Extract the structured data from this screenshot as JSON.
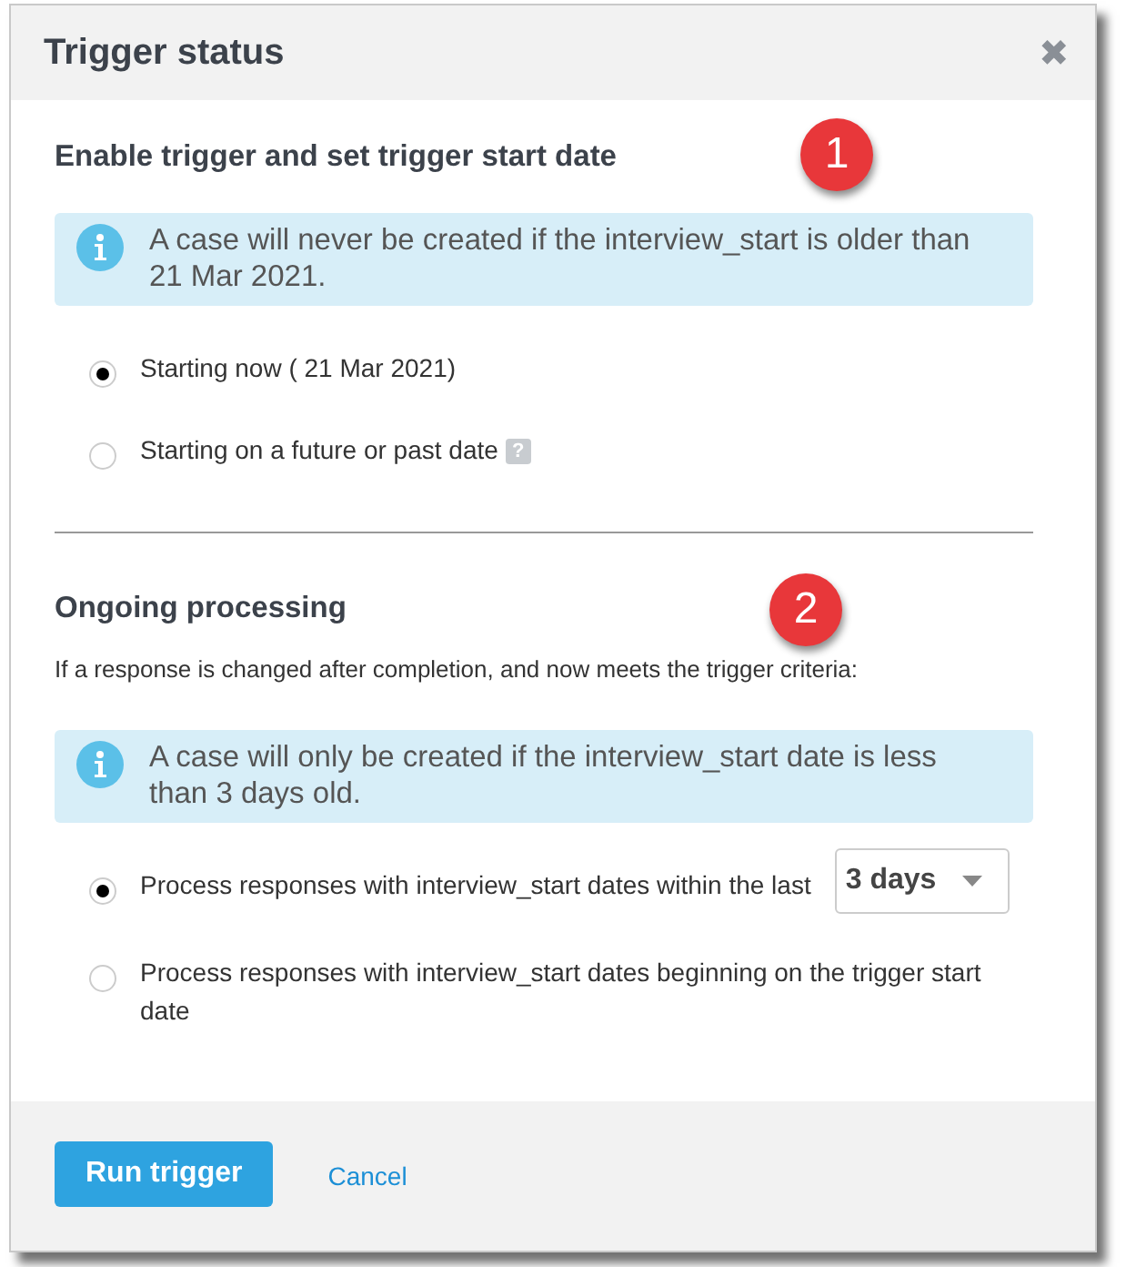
{
  "dialog": {
    "title": "Trigger status",
    "close": "✖"
  },
  "sections": [
    {
      "heading": "Enable trigger and set trigger start date",
      "marker": "1",
      "info": "A case will never be created if the interview_start is older than 21 Mar 2021.",
      "options": [
        {
          "label": "Starting now ( 21 Mar 2021)",
          "selected": true
        },
        {
          "label": "Starting on a future or past date",
          "selected": false,
          "help": "?"
        }
      ]
    },
    {
      "heading": "Ongoing processing",
      "marker": "2",
      "intro": "If a response is changed after completion, and now meets the trigger criteria:",
      "info": "A case will only be created if the interview_start date is less than 3 days old.",
      "options": [
        {
          "label": "Process responses with interview_start dates within the last",
          "selected": true,
          "select": "3 days"
        },
        {
          "label": "Process responses with interview_start dates beginning on the trigger start date",
          "selected": false
        }
      ]
    }
  ],
  "footer": {
    "primary": "Run trigger",
    "secondary": "Cancel"
  }
}
